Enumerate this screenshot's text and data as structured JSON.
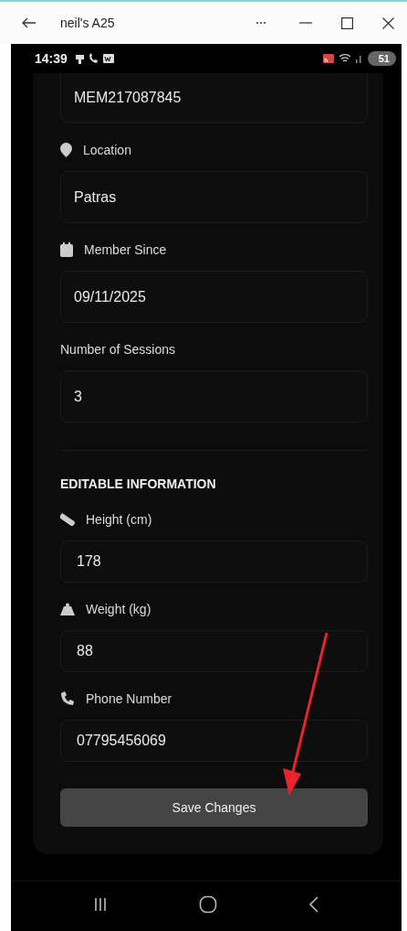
{
  "window": {
    "title": "neil's A25"
  },
  "status_bar": {
    "time": "14:39",
    "battery": "51"
  },
  "readonly_fields": [
    {
      "value": "MEM217087845"
    },
    {
      "kind": "pin",
      "label": "Location",
      "value": "Patras"
    },
    {
      "kind": "calendar",
      "label": "Member Since",
      "value": "09/11/2025"
    },
    {
      "kind": "none",
      "label": "Number of Sessions",
      "value": "3"
    }
  ],
  "editable_section": {
    "heading": "EDITABLE INFORMATION",
    "fields": [
      {
        "kind": "ruler",
        "label": "Height (cm)",
        "value": "178"
      },
      {
        "kind": "weight",
        "label": "Weight (kg)",
        "value": "88"
      },
      {
        "kind": "phone",
        "label": "Phone Number",
        "value": "07795456069"
      }
    ]
  },
  "save_button": "Save Changes"
}
